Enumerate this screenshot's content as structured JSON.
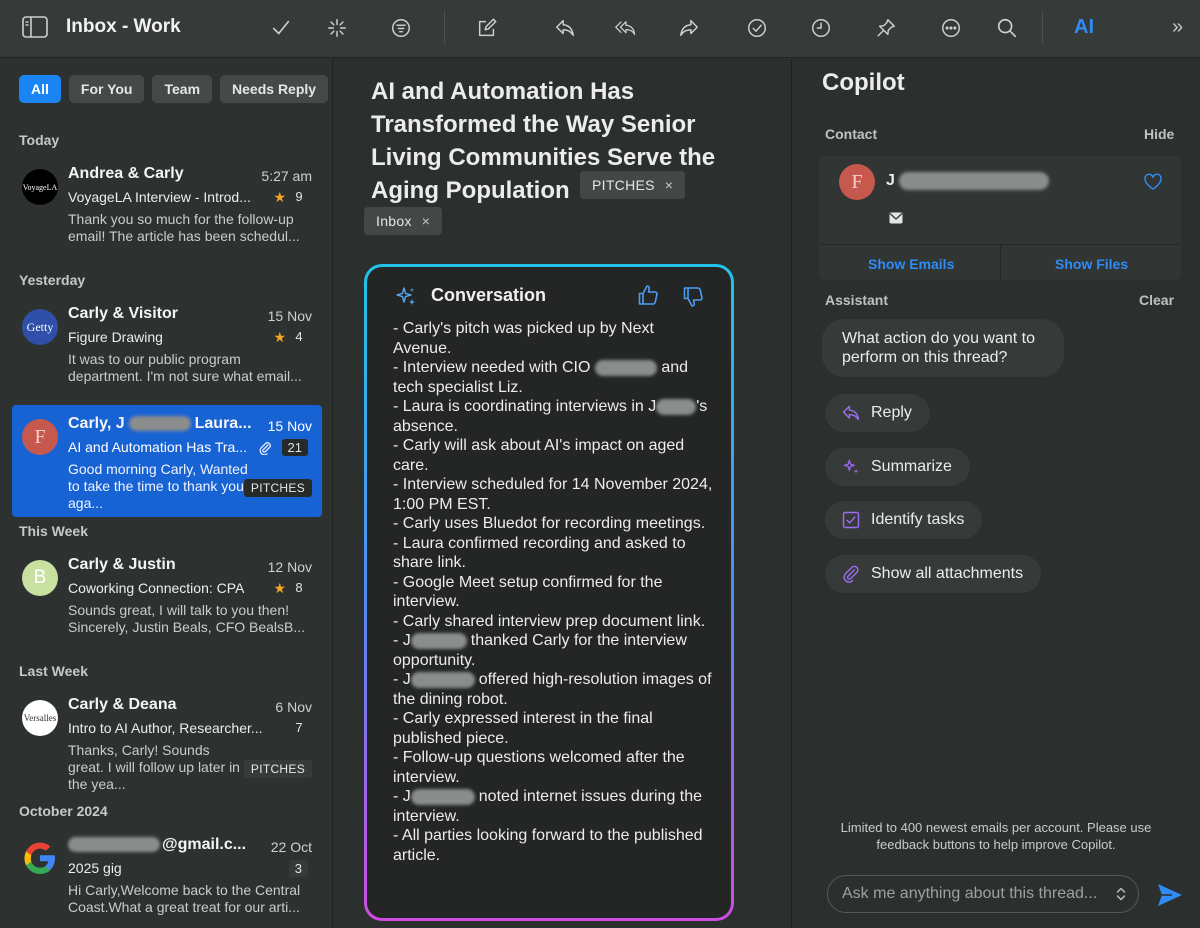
{
  "toolbar": {
    "title": "Inbox - Work",
    "ai_label": "AI",
    "more_label": "»",
    "icons": [
      "sidebar-icon",
      "checkmark-icon",
      "sparkle-icon",
      "filter-icon",
      "compose-icon",
      "reply-icon",
      "reply-all-icon",
      "forward-icon",
      "done-icon",
      "clock-icon",
      "pin-icon",
      "more-icon",
      "search-icon"
    ]
  },
  "sidebar": {
    "tabs": [
      {
        "label": "All",
        "active": true
      },
      {
        "label": "For You",
        "active": false
      },
      {
        "label": "Team",
        "active": false
      },
      {
        "label": "Needs Reply",
        "active": false
      }
    ],
    "sections": {
      "today": "Today",
      "yesterday": "Yesterday",
      "this_week": "This Week",
      "last_week": "Last Week",
      "october": "October 2024"
    },
    "mails": [
      {
        "from": "Andrea & Carly",
        "date": "5:27 am",
        "subject": "VoyageLA Interview - Introd...",
        "star": "★",
        "count": "9",
        "preview": "Thank you so much for the follow-up email! The article has been schedul...",
        "avatar_text": "VoyageLA",
        "tag": ""
      },
      {
        "from": "Carly & Visitor",
        "date": "15 Nov",
        "subject": "Figure Drawing",
        "star": "★",
        "count": "4",
        "preview": "It was to our public program department. I'm not sure what email...",
        "avatar_text": "Getty",
        "tag": ""
      },
      {
        "from_a": "Carly, J",
        "from_b": "Laura...",
        "date": "15 Nov",
        "subject": "AI and Automation Has Tra...",
        "count": "21",
        "preview": "Good morning Carly, Wanted to take the time to thank you aga...",
        "avatar_text": "F",
        "tag": "PITCHES"
      },
      {
        "from": "Carly & Justin",
        "date": "12 Nov",
        "subject": "Coworking Connection: CPA",
        "star": "★",
        "count": "8",
        "preview": "Sounds great, I will talk to you then! Sincerely, Justin Beals, CFO BealsB...",
        "avatar_text": "B",
        "tag": ""
      },
      {
        "from": "Carly & Deana",
        "date": "6 Nov",
        "subject": "Intro to AI Author, Researcher...",
        "count": "7",
        "preview": "Thanks, Carly! Sounds great. I will follow up later in the yea...",
        "avatar_text": "Versalles",
        "tag": "PITCHES"
      },
      {
        "from": "@gmail.c...",
        "date": "22 Oct",
        "subject": "2025 gig",
        "count": "3",
        "preview": "Hi Carly,Welcome back to the Central Coast.What a great treat for our arti...",
        "avatar_text": "G",
        "tag": ""
      }
    ]
  },
  "thread": {
    "title": "AI and Automation Has Transformed the Way Senior Living Communities Serve the Aging Population",
    "chips": {
      "pitches": "PITCHES",
      "inbox": "Inbox",
      "remove": "×"
    },
    "conversation": {
      "heading": "Conversation",
      "lines": [
        "- Carly's pitch was picked up by Next Avenue.",
        "- Interview needed with CIO",
        "and tech specialist Liz.",
        "- Laura is coordinating interviews in J",
        "'s absence.",
        "- Carly will ask about AI's impact on aged care.",
        "- Interview scheduled for 14 November 2024, 1:00 PM EST.",
        "- Carly uses Bluedot for recording meetings.",
        "- Laura confirmed recording and asked to share link.",
        "- Google Meet setup confirmed for the interview.",
        "- Carly shared interview prep document link.",
        "- J",
        "thanked Carly for the interview opportunity.",
        "- J",
        "offered high-resolution images of the dining robot.",
        "- Carly expressed interest in the final published piece.",
        "- Follow-up questions welcomed after the interview.",
        "- J",
        "noted internet issues during the interview.",
        "- All parties looking forward to the published article."
      ]
    }
  },
  "copilot": {
    "title": "Copilot",
    "contact_label": "Contact",
    "hide_label": "Hide",
    "contact_name": "J",
    "contact_avatar": "F",
    "show_emails": "Show Emails",
    "show_files": "Show Files",
    "assistant_label": "Assistant",
    "clear_label": "Clear",
    "question": "What action do you want to perform on this thread?",
    "actions": {
      "reply": "Reply",
      "summarize": "Summarize",
      "tasks": "Identify tasks",
      "attachments": "Show all attachments"
    },
    "footnote": "Limited to 400 newest emails per account. Please use feedback buttons to help improve Copilot.",
    "input_placeholder": "Ask me anything about this thread..."
  },
  "colors": {
    "accent": "#1a84f5",
    "selected": "#1863d4",
    "star": "#f5a623",
    "action_purple": "#9b6cf0"
  }
}
